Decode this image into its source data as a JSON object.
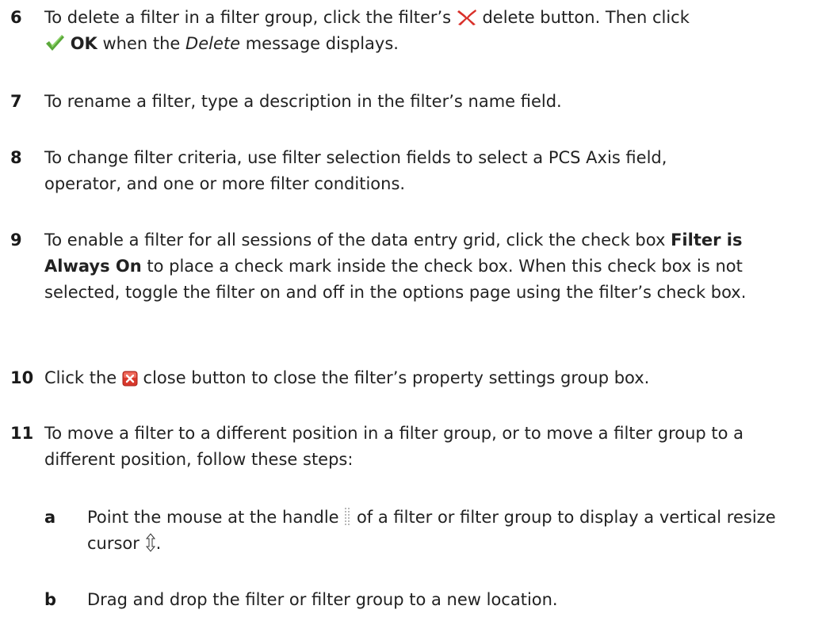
{
  "steps": [
    {
      "num": "6",
      "t1": "To delete a filter in a filter group, click the filter’s ",
      "t2": " delete button. Then click",
      "t3": " ",
      "bold": "OK",
      "t4": " when the ",
      "italic": "Delete",
      "t5": " message displays."
    },
    {
      "num": "7",
      "t1": "To rename a filter, type a description in the filter’s name field."
    },
    {
      "num": "8",
      "t1": "To change filter criteria, use filter selection fields to select a PCS Axis field,",
      "t2": "operator, and one or more filter conditions."
    },
    {
      "num": "9",
      "t1": "To enable a filter for all sessions of the data entry grid, click the check box ",
      "bold": "Filter is Always On",
      "t2": " to place a check mark inside the check box. When this check box is not selected, toggle the filter on and off in the options page using the filter’s check box."
    },
    {
      "num": "10",
      "t1": "Click the ",
      "t2": " close button to close the filter’s property settings group box."
    },
    {
      "num": "11",
      "t1": "To move a filter to a different position in a filter group, or to move a filter group to a different position, follow these steps:"
    }
  ],
  "substeps": [
    {
      "num": "a",
      "t1": "Point the mouse at the handle ",
      "t2": " of a filter or filter group to display a vertical resize cursor ",
      "t3": "."
    },
    {
      "num": "b",
      "t1": "Drag and drop the filter or filter group to a new location."
    }
  ],
  "icons": {
    "delete": "red-x-delete-icon",
    "ok": "green-checkmark-icon",
    "close": "red-close-box-icon",
    "handle": "drag-handle-icon",
    "cursor": "vertical-resize-cursor-icon"
  },
  "colors": {
    "delete_red": "#d9302a",
    "ok_green": "#5aa83a",
    "close_red": "#d8382c"
  }
}
